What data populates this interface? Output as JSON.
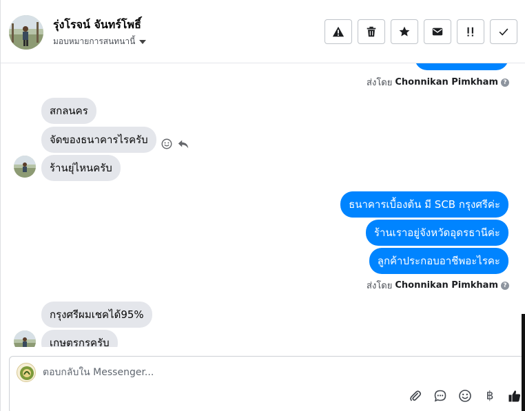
{
  "header": {
    "contact_name": "รุ่งโรจน์ จันทร์โพธิ์",
    "assign_label": "มอบหมายการสนทนานี้",
    "actions": [
      {
        "name": "spam-button",
        "icon": "warning-icon"
      },
      {
        "name": "delete-button",
        "icon": "trash-icon"
      },
      {
        "name": "star-button",
        "icon": "star-icon"
      },
      {
        "name": "unread-button",
        "icon": "envelope-icon"
      },
      {
        "name": "follow-up-button",
        "icon": "follow-up-icon"
      },
      {
        "name": "done-button",
        "icon": "checkmark-icon"
      }
    ]
  },
  "messages": {
    "sent_by_prefix": "ส่งโดย",
    "sent_by_name": "Chonnikan Pimkham",
    "incoming_1": [
      "สกลนคร",
      "จัดของธนาคารไรครับ",
      "ร้านยุ่ไหนครับ"
    ],
    "outgoing_1": [
      "ธนาคารเบื้องต้น มี SCB กรุงศรีค่ะ",
      "ร้านเราอยู่จังหวัดอุดรธานีค่ะ",
      "ลูกค้าประกอบอาชีพอะไรคะ"
    ],
    "incoming_2": [
      "กรุงศรีผมเชคได้95%",
      "เกษตรกรครับ"
    ]
  },
  "composer": {
    "placeholder": "ตอบกลับใน Messenger...",
    "currency_symbol": "฿",
    "tools": [
      "paperclip-icon",
      "speech-bubble-icon",
      "smiley-icon",
      "baht-icon",
      "thumbs-up-icon"
    ]
  },
  "colors": {
    "outgoing_bubble": "#0084ff",
    "incoming_bubble": "#e4e6eb",
    "action_border": "#bec3c9"
  }
}
